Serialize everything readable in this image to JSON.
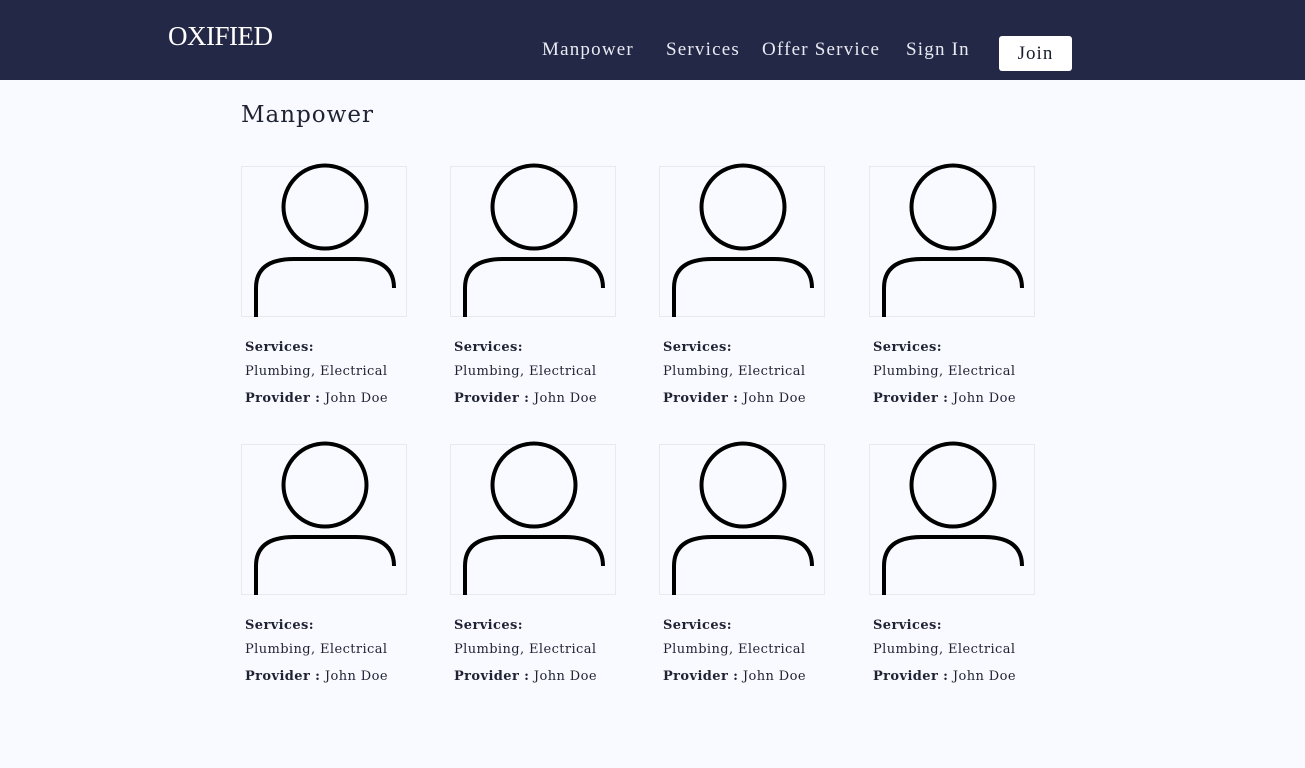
{
  "brand": {
    "logo": "OXIFIED"
  },
  "nav": {
    "links": [
      "Manpower",
      "Services",
      "Offer Service",
      "Sign In"
    ],
    "join_label": "Join"
  },
  "page": {
    "title": "Manpower"
  },
  "cards": [
    {
      "services_label": "Services:",
      "services": "Plumbing, Electrical",
      "provider_label": "Provider :",
      "provider": "John Doe"
    },
    {
      "services_label": "Services:",
      "services": "Plumbing, Electrical",
      "provider_label": "Provider :",
      "provider": "John Doe"
    },
    {
      "services_label": "Services:",
      "services": "Plumbing, Electrical",
      "provider_label": "Provider :",
      "provider": "John Doe"
    },
    {
      "services_label": "Services:",
      "services": "Plumbing, Electrical",
      "provider_label": "Provider :",
      "provider": "John Doe"
    },
    {
      "services_label": "Services:",
      "services": "Plumbing, Electrical",
      "provider_label": "Provider :",
      "provider": "John Doe"
    },
    {
      "services_label": "Services:",
      "services": "Plumbing, Electrical",
      "provider_label": "Provider :",
      "provider": "John Doe"
    },
    {
      "services_label": "Services:",
      "services": "Plumbing, Electrical",
      "provider_label": "Provider :",
      "provider": "John Doe"
    },
    {
      "services_label": "Services:",
      "services": "Plumbing, Electrical",
      "provider_label": "Provider :",
      "provider": "John Doe"
    }
  ],
  "icons": {
    "avatar": "user-avatar-icon"
  },
  "colors": {
    "navbar": "#242847",
    "background": "#f9faff",
    "text": "#1f2233",
    "button_bg": "#ffffff"
  }
}
